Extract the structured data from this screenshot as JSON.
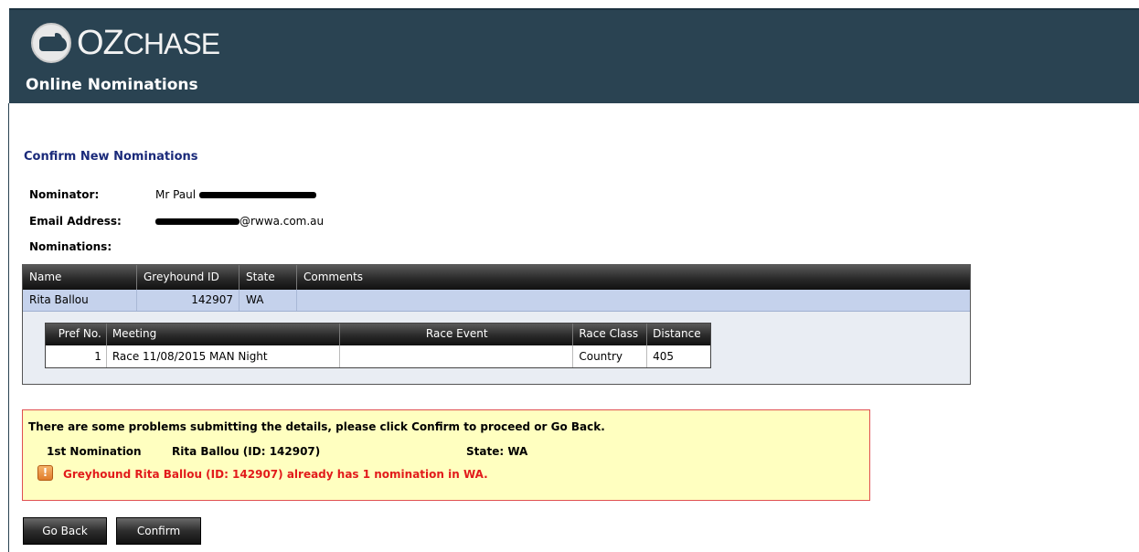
{
  "header": {
    "logo_text_1": "OZ",
    "logo_text_2": "CHASE",
    "subtitle": "Online Nominations"
  },
  "page": {
    "title": "Confirm New Nominations"
  },
  "info": {
    "nominator_label": "Nominator:",
    "nominator_value_prefix": "Mr Paul",
    "email_label": "Email Address:",
    "email_suffix": "@rwwa.com.au",
    "nominations_label": "Nominations:"
  },
  "grid": {
    "headers": [
      "Name",
      "Greyhound ID",
      "State",
      "Comments"
    ],
    "row": {
      "name": "Rita Ballou",
      "id": "142907",
      "state": "WA",
      "comments": ""
    },
    "sub_headers": [
      "Pref No.",
      "Meeting",
      "Race Event",
      "Race Class",
      "Distance"
    ],
    "sub_row": {
      "pref": "1",
      "meeting": "Race 11/08/2015 MAN Night",
      "event": "",
      "class": "Country",
      "distance": "405"
    }
  },
  "warning": {
    "message": "There are some problems submitting the details, please click Confirm to proceed or Go Back.",
    "nomination_label": "1st Nomination",
    "nomination_name": "Rita Ballou (ID: 142907)",
    "state": "State: WA",
    "error": "Greyhound Rita Ballou (ID: 142907) already has 1 nomination in WA.",
    "icon": "!"
  },
  "buttons": {
    "go_back": "Go Back",
    "confirm": "Confirm"
  },
  "colors": {
    "header_bg": "#2a4352",
    "title_color": "#1a2a7a",
    "selected_row": "#c5d2ec",
    "warning_bg": "#ffffc0",
    "error_red": "#e21b1b"
  }
}
